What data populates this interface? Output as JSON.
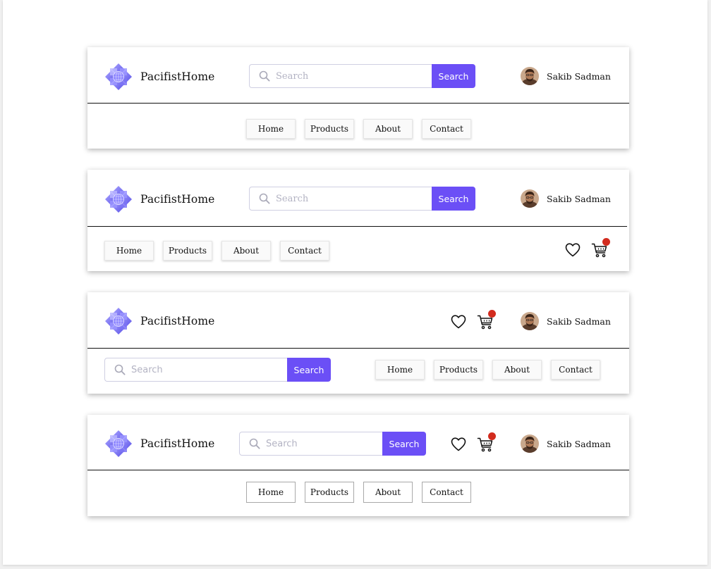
{
  "brand": {
    "name": "PacifistHome",
    "icon": "lotus-logo-icon"
  },
  "search": {
    "placeholder": "Search",
    "button_label": "Search",
    "icon": "search-icon"
  },
  "user": {
    "name": "Sakib Sadman",
    "icon": "avatar"
  },
  "nav": {
    "items": [
      "Home",
      "Products",
      "About",
      "Contact"
    ]
  },
  "actions": {
    "wishlist_icon": "heart-icon",
    "cart_icon": "cart-icon",
    "cart_has_badge": true
  },
  "colors": {
    "accent": "#6b4ff6",
    "badge": "#d22b1e",
    "logo": "#7b74f0"
  }
}
